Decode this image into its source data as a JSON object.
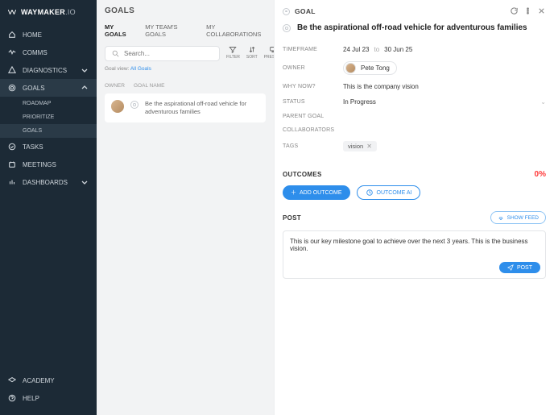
{
  "brand": {
    "name": "WAYMAKER",
    "suffix": ".IO"
  },
  "nav": {
    "home": "HOME",
    "comms": "COMMS",
    "diagnostics": "DIAGNOSTICS",
    "goals": "GOALS",
    "goals_sub": {
      "roadmap": "ROADMAP",
      "prioritize": "PRIORITIZE",
      "goals": "GOALS"
    },
    "tasks": "TASKS",
    "meetings": "MEETINGS",
    "dashboards": "DASHBOARDS",
    "academy": "ACADEMY",
    "help": "HELP"
  },
  "mid": {
    "title": "GOALS",
    "tabs": {
      "my": "MY GOALS",
      "team": "MY TEAM'S GOALS",
      "collab": "MY COLLABORATIONS"
    },
    "search_placeholder": "Search...",
    "tools": {
      "filter": "FILTER",
      "sort": "SORT",
      "present": "PRESENT"
    },
    "goalview_label": "Goal view:",
    "goalview_link": "All Goals",
    "columns": {
      "owner": "OWNER",
      "name": "GOAL NAME"
    },
    "row1": "Be the aspirational off-road vehicle for adventurous families"
  },
  "detail": {
    "header": "GOAL",
    "title": "Be the aspirational off-road vehicle for adventurous families",
    "labels": {
      "timeframe": "TIMEFRAME",
      "owner": "OWNER",
      "why": "WHY NOW?",
      "status": "STATUS",
      "parent": "PARENT GOAL",
      "collaborators": "COLLABORATORS",
      "tags": "TAGS",
      "outcomes": "OUTCOMES",
      "post": "POST"
    },
    "timeframe": {
      "from": "24 Jul 23",
      "to_word": "to",
      "to": "30 Jun 25"
    },
    "owner": "Pete Tong",
    "why": "This is the company vision",
    "status": "In Progress",
    "tag": "vision",
    "outcomes_pct": "0%",
    "buttons": {
      "add_outcome": "ADD OUTCOME",
      "outcome_ai": "OUTCOME AI",
      "show_feed": "SHOW FEED",
      "post": "POST"
    },
    "post_text": "This is our key milestone goal to achieve over the next 3 years. This is the business vision."
  }
}
